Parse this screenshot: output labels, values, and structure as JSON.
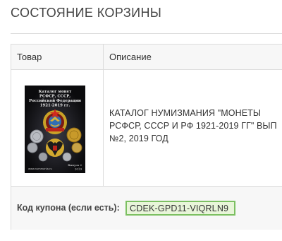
{
  "cart": {
    "title": "СОСТОЯНИЕ КОРЗИНЫ",
    "columns": {
      "product": "Товар",
      "description": "Описание"
    },
    "item": {
      "cover": {
        "lines": [
          "Каталог монет",
          "РСФСР, СССР,",
          "Российской Федерации",
          "1921-2019 гг."
        ],
        "issue": "Выпуск 2",
        "year": "2019",
        "publisher": "www.nummania.ru"
      },
      "description_lines": [
        "КАТАЛОГ НУМИЗМАНИЯ \"МОНЕТЫ",
        "РСФСР, СССР И РФ 1921-2019 ГГ\" ВЫП",
        "№2, 2019 ГОД"
      ]
    },
    "coupon": {
      "label": "Код купона (если есть):",
      "value": "CDEK-GPD11-VIQRLN9"
    }
  },
  "colors": {
    "border": "#dcdcdc",
    "header_bg": "#f7f7f7",
    "coupon_highlight": "#e8f5d9",
    "coupon_border": "#7cc062",
    "cover_bg": "#0b0b0d"
  }
}
